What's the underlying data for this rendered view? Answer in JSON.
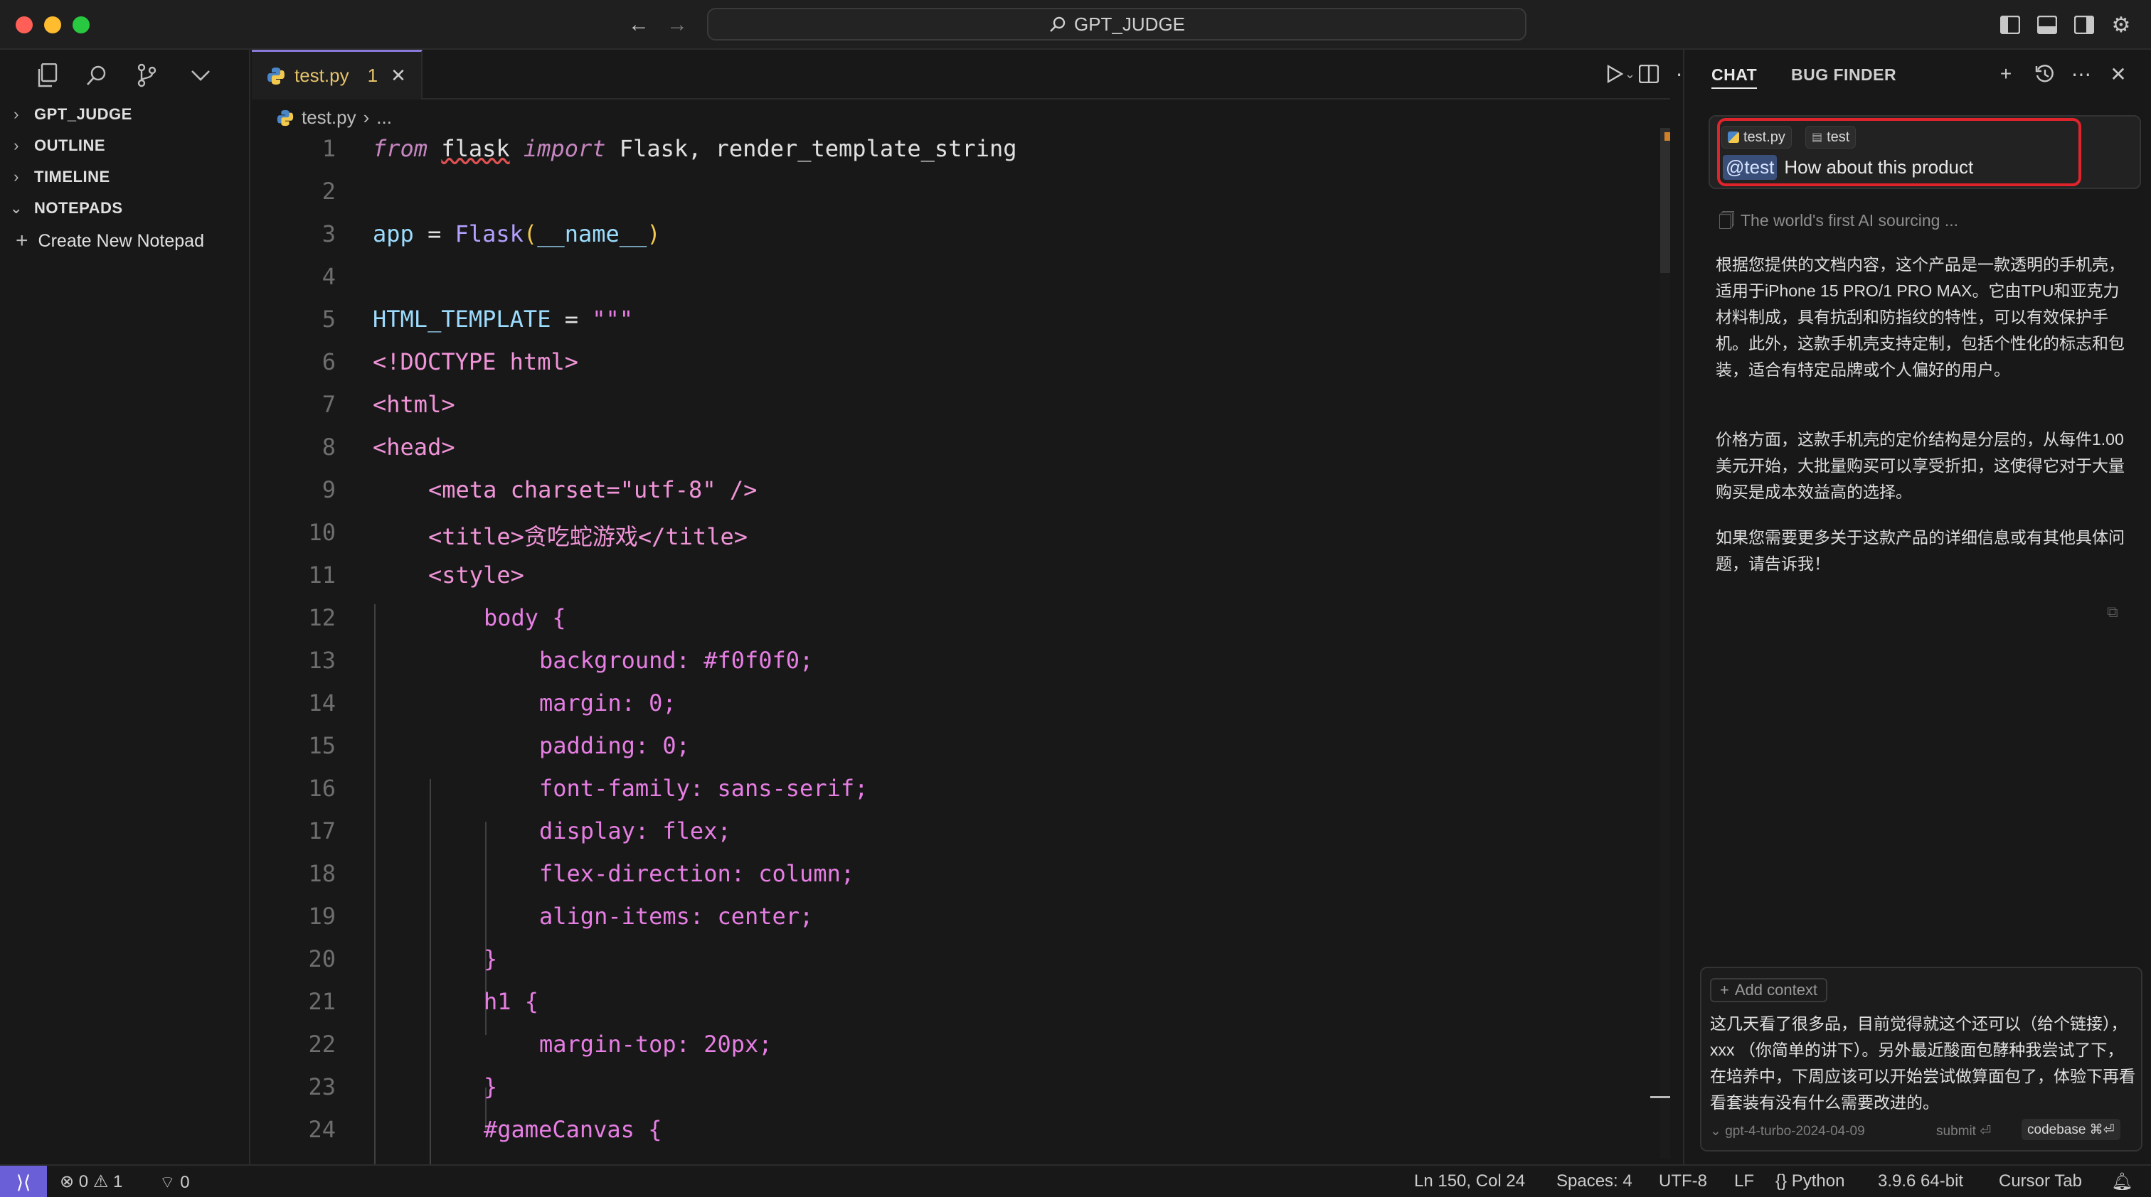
{
  "window": {
    "title": "GPT_JUDGE"
  },
  "sidebar": {
    "sections": [
      {
        "label": "GPT_JUDGE",
        "expanded": false
      },
      {
        "label": "OUTLINE",
        "expanded": false
      },
      {
        "label": "TIMELINE",
        "expanded": false
      },
      {
        "label": "NOTEPADS",
        "expanded": true
      }
    ],
    "create_notepad": "Create New Notepad"
  },
  "editor": {
    "tab": {
      "filename": "test.py",
      "problems": "1"
    },
    "breadcrumb": {
      "file": "test.py",
      "rest": "..."
    },
    "line_numbers": [
      "1",
      "2",
      "3",
      "4",
      "5",
      "6",
      "7",
      "8",
      "9",
      "10",
      "11",
      "12",
      "13",
      "14",
      "15",
      "16",
      "17",
      "18",
      "19",
      "20",
      "21",
      "22",
      "23",
      "24"
    ],
    "lines": {
      "l1": {
        "kw1": "from",
        "mod": "flask",
        "kw2": "import",
        "rest": "Flask, render_template_string"
      },
      "l3": {
        "var": "app",
        "eq": " = ",
        "fn": "Flask",
        "open": "(",
        "arg": "__name__",
        "close": ")"
      },
      "l5": {
        "var": "HTML_TEMPLATE",
        "eq": " = ",
        "str": "\"\"\""
      },
      "l6": "<!DOCTYPE html>",
      "l7": "<html>",
      "l8": "<head>",
      "l9": "<meta charset=\"utf-8\" />",
      "l10": "<title>贪吃蛇游戏</title>",
      "l11": "<style>",
      "l12": "body {",
      "l13": "background: #f0f0f0;",
      "l14": "margin: 0;",
      "l15": "padding: 0;",
      "l16": "font-family: sans-serif;",
      "l17": "display: flex;",
      "l18": "flex-direction: column;",
      "l19": "align-items: center;",
      "l20": "}",
      "l21": "h1 {",
      "l22": "margin-top: 20px;",
      "l23": "}",
      "l24": "#gameCanvas {"
    }
  },
  "chat": {
    "tabs": [
      "CHAT",
      "BUG FINDER"
    ],
    "query": {
      "chips": [
        "test.py",
        "test"
      ],
      "mention": "@test",
      "text": "How about this product"
    },
    "reference": "The world's first AI sourcing ...",
    "response": [
      "根据您提供的文档内容，这个产品是一款透明的手机壳，适用于iPhone 15 PRO/1 PRO MAX。它由TPU和亚克力材料制成，具有抗刮和防指纹的特性，可以有效保护手机。此外，这款手机壳支持定制，包括个性化的标志和包装，适合有特定品牌或个人偏好的用户。",
      "价格方面，这款手机壳的定价结构是分层的，从每件1.00美元开始，大批量购买可以享受折扣，这使得它对于大量购买是成本效益高的选择。",
      "如果您需要更多关于这款产品的详细信息或有其他具体问题，请告诉我！"
    ],
    "input": {
      "add_context": "Add context",
      "draft": "这几天看了很多品，目前觉得就这个还可以（给个链接），xxx （你简单的讲下）。另外最近酸面包酵种我尝试了下，在培养中，下周应该可以开始尝试做算面包了，体验下再看看套装有没有什么需要改进的。",
      "model": "gpt-4-turbo-2024-04-09",
      "submit": "submit ⏎",
      "codebase": "codebase ⌘⏎"
    }
  },
  "status": {
    "errors": "0",
    "warnings": "1",
    "ports": "0",
    "position": "Ln 150, Col 24",
    "spaces": "Spaces: 4",
    "encoding": "UTF-8",
    "eol": "LF",
    "language": "Python",
    "interpreter": "3.9.6 64-bit",
    "cursor_tab": "Cursor Tab"
  },
  "colors": {
    "accent": "#6b5fd8",
    "highlight_box": "#e0242c"
  }
}
